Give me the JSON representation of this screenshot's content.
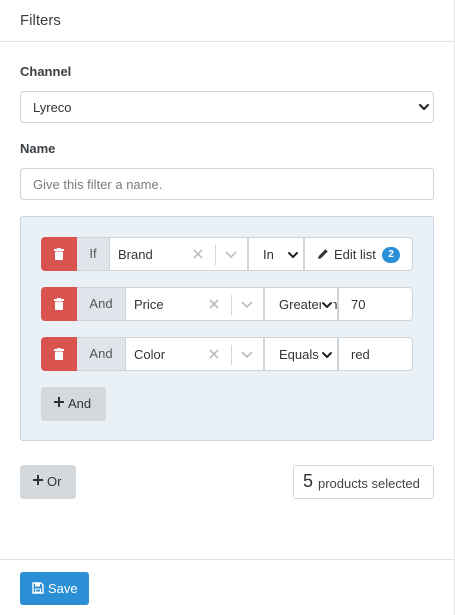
{
  "header": {
    "title": "Filters"
  },
  "channel": {
    "label": "Channel",
    "value": "Lyreco"
  },
  "name": {
    "label": "Name",
    "placeholder": "Give this filter a name."
  },
  "rules": [
    {
      "conjunction": "If",
      "field": "Brand",
      "operator": "In",
      "edit_label": "Edit list",
      "list_count": "2"
    },
    {
      "conjunction": "And",
      "field": "Price",
      "operator": "Greater than",
      "value": "70"
    },
    {
      "conjunction": "And",
      "field": "Color",
      "operator": "Equals",
      "value": "red"
    }
  ],
  "add_and_label": "And",
  "add_or_label": "Or",
  "products": {
    "count": "5",
    "label": "products selected"
  },
  "save_label": "Save",
  "colors": {
    "danger": "#d9534f",
    "primary": "#2b8fd6",
    "group_bg": "#e9f0f6"
  },
  "icons": [
    "chevron-down-icon",
    "trash-icon",
    "clear-icon",
    "pencil-icon",
    "plus-icon",
    "save-icon"
  ]
}
